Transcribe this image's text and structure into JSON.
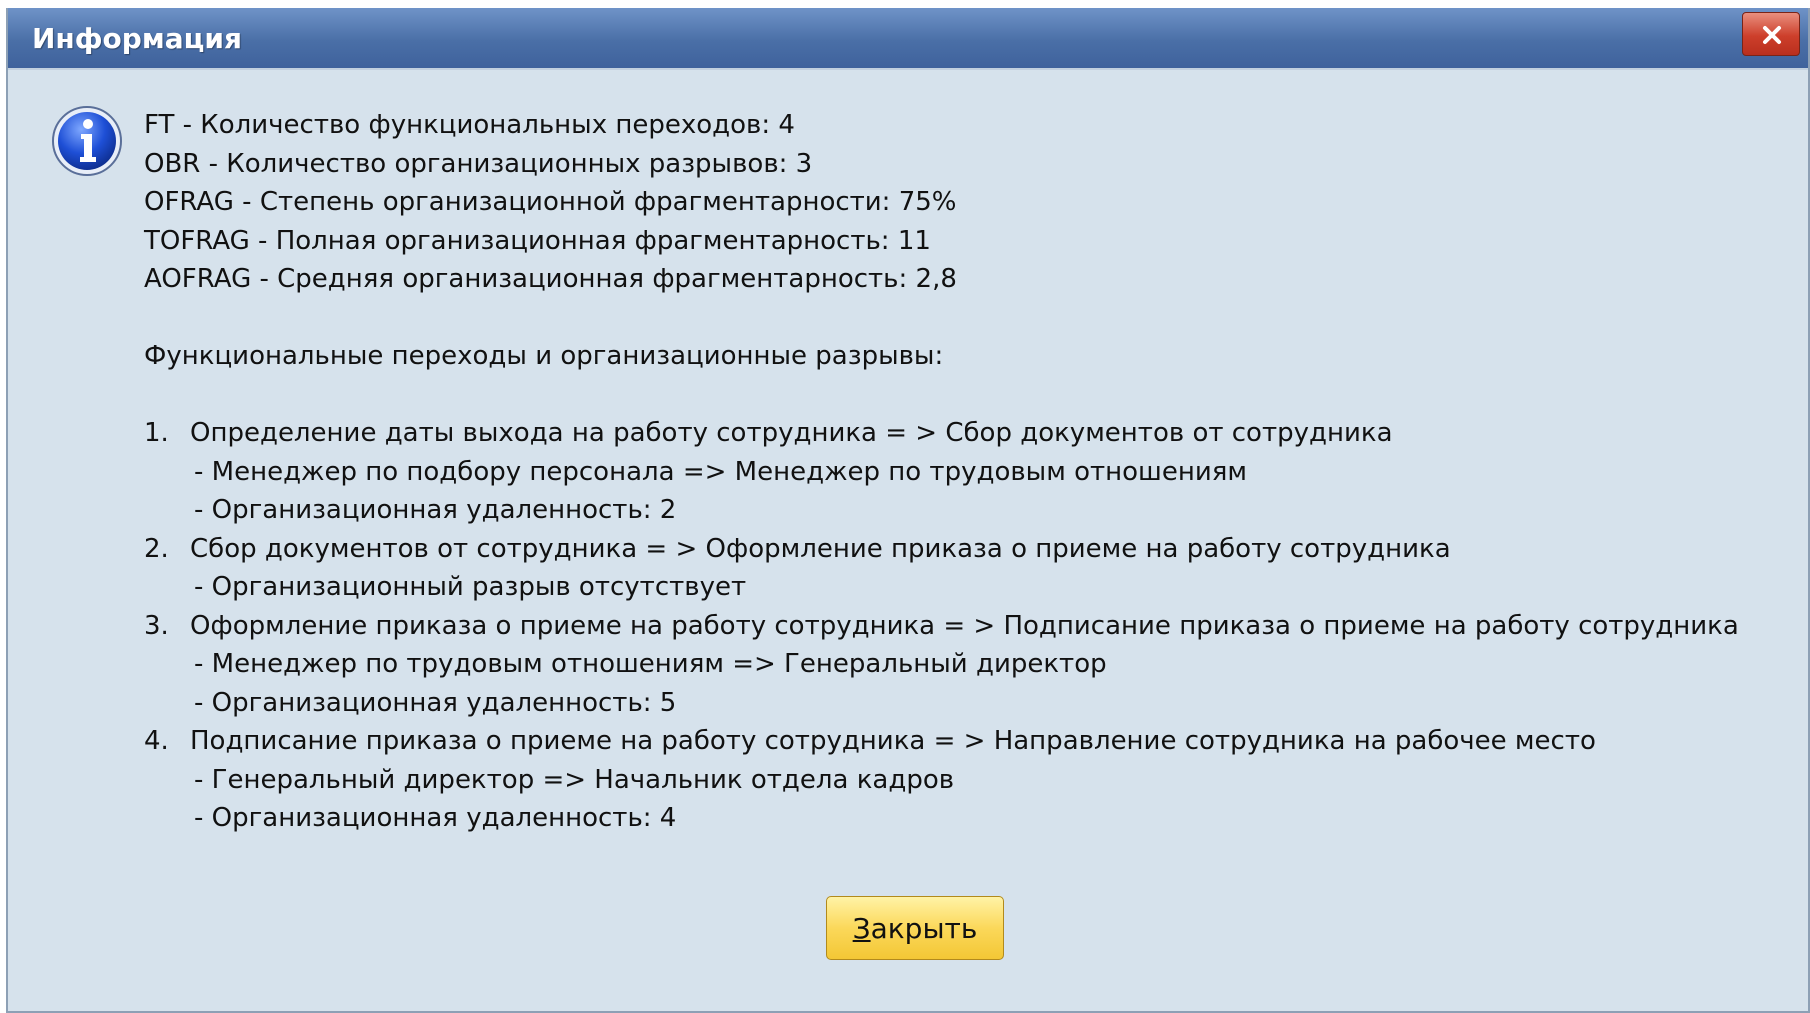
{
  "dialog": {
    "title": "Информация",
    "close_button_label": "Закрыть",
    "close_button_accel": "З",
    "close_button_rest": "акрыть"
  },
  "metrics": [
    "FT - Количество функциональных переходов: 4",
    "OBR - Количество организационных разрывов: 3",
    "OFRAG - Степень организационной фрагментарности: 75%",
    "TOFRAG - Полная организационная фрагментарность: 11",
    "AOFRAG - Средняя организационная фрагментарность: 2,8"
  ],
  "section_heading": "Функциональные переходы и организационные разрывы:",
  "transitions": [
    {
      "number": "1.",
      "text": "Определение даты выхода на работу сотрудника = > Сбор документов от сотрудника",
      "details": [
        "- Менеджер по подбору персонала => Менеджер по трудовым отношениям",
        "- Организационная удаленность: 2"
      ]
    },
    {
      "number": "2.",
      "text": "Сбор документов от сотрудника = > Оформление приказа о приеме на работу сотрудника",
      "details": [
        "- Организационный разрыв отсутствует"
      ]
    },
    {
      "number": "3.",
      "text": "Оформление приказа о приеме на работу сотрудника = > Подписание приказа о приеме на работу сотрудника",
      "details": [
        "- Менеджер по трудовым отношениям => Генеральный директор",
        "- Организационная удаленность: 5"
      ]
    },
    {
      "number": "4.",
      "text": "Подписание приказа о приеме на работу сотрудника = > Направление сотрудника на рабочее место",
      "details": [
        "- Генеральный директор => Начальник отдела кадров",
        "- Организационная удаленность: 4"
      ]
    }
  ],
  "icons": {
    "window_close": "close-icon",
    "message": "info-icon"
  }
}
